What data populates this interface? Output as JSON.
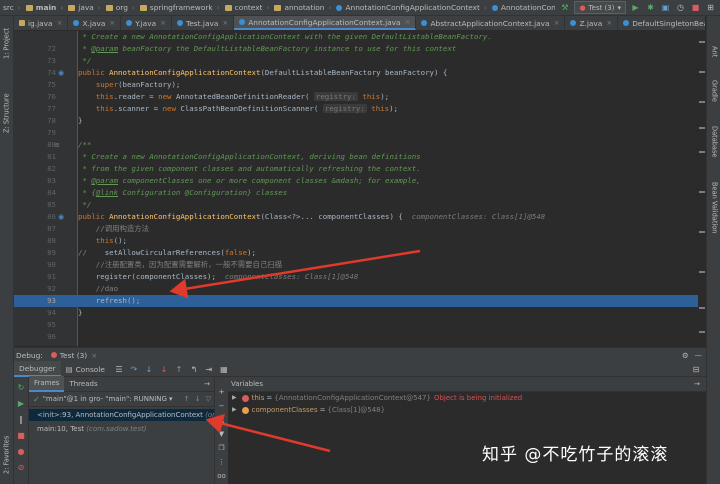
{
  "nav": {
    "crumbs": [
      "src",
      "main",
      "java",
      "org",
      "springframework",
      "context",
      "annotation",
      "AnnotationConfigApplicationContext",
      "AnnotationConfigApplicationContext"
    ],
    "run_config": "Test (3)"
  },
  "tabs": [
    {
      "label": "ig.java",
      "kind": "java"
    },
    {
      "label": "X.java",
      "kind": "class"
    },
    {
      "label": "Y.java",
      "kind": "class"
    },
    {
      "label": "Test.java",
      "kind": "class"
    },
    {
      "label": "AnnotationConfigApplicationContext.java",
      "kind": "class",
      "active": true
    },
    {
      "label": "AbstractApplicationContext.java",
      "kind": "class"
    },
    {
      "label": "Z.java",
      "kind": "class"
    },
    {
      "label": "DefaultSingletonBeanRegistry.java",
      "kind": "class"
    }
  ],
  "left_strip": {
    "project": "1: Project",
    "structure": "Z: Structure",
    "favorites": "2: Favorites"
  },
  "right_strip": {
    "ant": "Ant",
    "gradle": "Gradle",
    "database": "Database",
    "bean_validation": "Bean Validation"
  },
  "editor": {
    "lines": [
      {
        "n": "",
        "parts": [
          [
            "cm",
            " * Create a new AnnotationConfigApplicationContext with the given DefaultListableBeanFactory."
          ]
        ]
      },
      {
        "n": "72",
        "parts": [
          [
            "cm",
            " * "
          ],
          [
            "tag",
            "@param"
          ],
          [
            "cm",
            " beanFactory the DefaultListableBeanFactory instance to use for this context"
          ]
        ]
      },
      {
        "n": "73",
        "parts": [
          [
            "cm",
            " */"
          ]
        ]
      },
      {
        "n": "74",
        "parts": [
          [
            "kw",
            "public "
          ],
          [
            "fn",
            "AnnotationConfigApplicationContext"
          ],
          [
            "pl",
            "(DefaultListableBeanFactory beanFactory) {"
          ]
        ]
      },
      {
        "n": "75",
        "parts": [
          [
            "pl",
            "    "
          ],
          [
            "kw",
            "super"
          ],
          [
            "pl",
            "(beanFactory);"
          ]
        ]
      },
      {
        "n": "76",
        "parts": [
          [
            "pl",
            "    "
          ],
          [
            "kw",
            "this"
          ],
          [
            "pl",
            ".reader = "
          ],
          [
            "kw",
            "new "
          ],
          [
            "pl",
            "AnnotatedBeanDefinitionReader( "
          ],
          [
            "hint",
            "registry:"
          ],
          [
            "pl",
            " "
          ],
          [
            "kw",
            "this"
          ],
          [
            "pl",
            ");"
          ]
        ]
      },
      {
        "n": "77",
        "parts": [
          [
            "pl",
            "    "
          ],
          [
            "kw",
            "this"
          ],
          [
            "pl",
            ".scanner = "
          ],
          [
            "kw",
            "new "
          ],
          [
            "pl",
            "ClassPathBeanDefinitionScanner( "
          ],
          [
            "hint",
            "registry:"
          ],
          [
            "pl",
            " "
          ],
          [
            "kw",
            "this"
          ],
          [
            "pl",
            ");"
          ]
        ]
      },
      {
        "n": "78",
        "parts": [
          [
            "pl",
            "}"
          ]
        ]
      },
      {
        "n": "79",
        "parts": [
          [
            "pl",
            ""
          ]
        ]
      },
      {
        "n": "80",
        "parts": [
          [
            "cm",
            "/**"
          ]
        ]
      },
      {
        "n": "81",
        "parts": [
          [
            "cm",
            " * Create a new AnnotationConfigApplicationContext, deriving bean definitions"
          ]
        ]
      },
      {
        "n": "82",
        "parts": [
          [
            "cm",
            " * from the given component classes and automatically refreshing the context."
          ]
        ]
      },
      {
        "n": "83",
        "parts": [
          [
            "cm",
            " * "
          ],
          [
            "tag",
            "@param"
          ],
          [
            "cm",
            " componentClasses one or more component classes &mdash; for example,"
          ]
        ]
      },
      {
        "n": "84",
        "parts": [
          [
            "cm",
            " * {"
          ],
          [
            "tag",
            "@link"
          ],
          [
            "cm",
            " Configuration @Configuration} classes"
          ]
        ]
      },
      {
        "n": "85",
        "parts": [
          [
            "cm",
            " */"
          ]
        ]
      },
      {
        "n": "86",
        "parts": [
          [
            "kw",
            "public "
          ],
          [
            "fn",
            "AnnotationConfigApplicationContext"
          ],
          [
            "pl",
            "(Class<?>... componentClasses) {  "
          ],
          [
            "dbg",
            "componentClasses: Class[1]@548"
          ]
        ]
      },
      {
        "n": "87",
        "parts": [
          [
            "cn",
            "    //调用构造方法"
          ]
        ]
      },
      {
        "n": "88",
        "parts": [
          [
            "pl",
            "    "
          ],
          [
            "kw",
            "this"
          ],
          [
            "pl",
            "();"
          ]
        ]
      },
      {
        "n": "89",
        "parts": [
          [
            "cn",
            "//  "
          ],
          [
            "pl",
            "  setAllowCircularReferences("
          ],
          [
            "kw",
            "false"
          ],
          [
            "pl",
            ");"
          ]
        ]
      },
      {
        "n": "90",
        "parts": [
          [
            "cn",
            "    //注册配置类，因为配置需要解析，一般不需要自己扫描"
          ]
        ]
      },
      {
        "n": "91",
        "parts": [
          [
            "pl",
            "    register(componentClasses);  "
          ],
          [
            "dbg",
            "componentClasses: Class[1]@548"
          ]
        ]
      },
      {
        "n": "92",
        "parts": [
          [
            "cn",
            "    //dao"
          ]
        ]
      },
      {
        "n": "93",
        "parts": [
          [
            "pl",
            "    refresh();"
          ]
        ],
        "highlight": true
      },
      {
        "n": "94",
        "parts": [
          [
            "pl",
            "}"
          ]
        ]
      },
      {
        "n": "95",
        "parts": [
          [
            "pl",
            ""
          ]
        ]
      },
      {
        "n": "96",
        "parts": [
          [
            "pl",
            ""
          ]
        ]
      },
      {
        "n": "97",
        "parts": [
          [
            "cm",
            "/**"
          ]
        ]
      },
      {
        "n": "98",
        "parts": [
          [
            "cm",
            " * Create a new AnnotationConfigApplicationContext, scanning for components"
          ]
        ]
      }
    ]
  },
  "debug": {
    "label": "Debug:",
    "tab": "Test (3)",
    "tabs": {
      "debugger": "Debugger",
      "console": "Console"
    },
    "subtabs": {
      "frames": "Frames",
      "threads": "Threads"
    },
    "variables_label": "Variables",
    "thread": "\"main\"@1 in gro- \"main\": RUNNING",
    "frames": [
      {
        "method": "<init>:93, AnnotationConfigApplicationContext",
        "pkg": "(org.",
        "selected": true
      },
      {
        "method": "main:10, Test",
        "pkg": "(com.sadow.test)",
        "selected": false
      }
    ],
    "variables": [
      {
        "name": "this",
        "value": "{AnnotationConfigApplicationContext@547}",
        "error": "Object is being initialized",
        "badge": "#db5c5c"
      },
      {
        "name": "componentClasses",
        "value": "{Class[1]@548}",
        "error": "",
        "badge": "#e89e4a"
      }
    ]
  },
  "watermark": "知乎 @不吃竹子的滚滚",
  "colors": {
    "background": "#2b2b2b",
    "highlight": "#2d6099",
    "arrow": "#e03a2c"
  }
}
